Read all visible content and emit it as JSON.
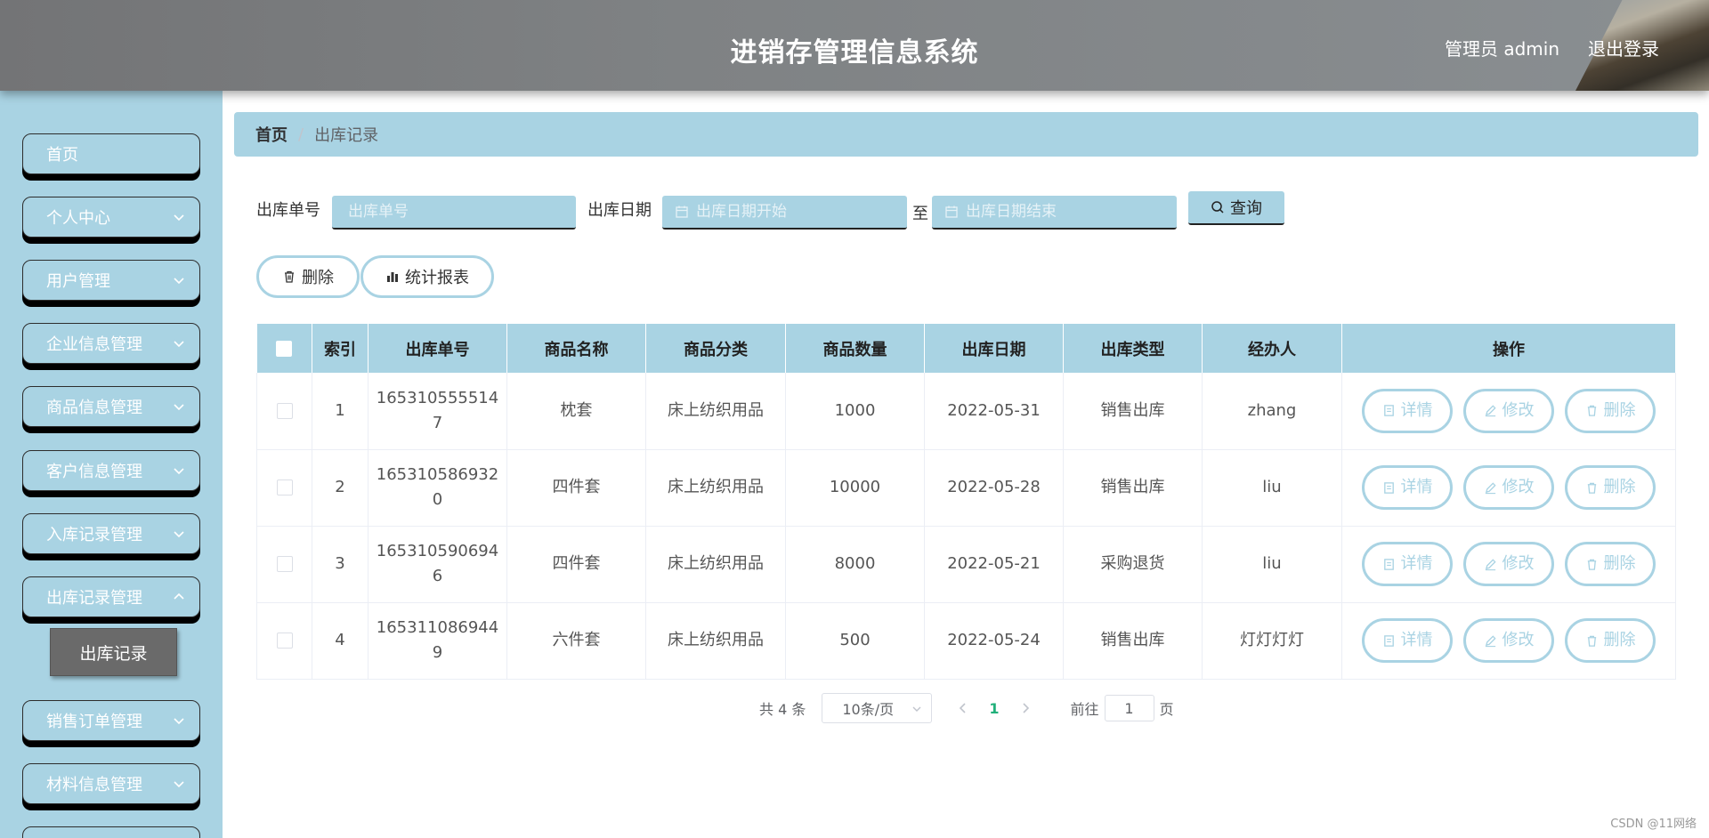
{
  "header": {
    "title": "进销存管理信息系统",
    "user": "管理员 admin",
    "logout": "退出登录"
  },
  "sidebar": {
    "items": [
      {
        "label": "首页",
        "expandable": false
      },
      {
        "label": "个人中心",
        "expandable": true
      },
      {
        "label": "用户管理",
        "expandable": true
      },
      {
        "label": "企业信息管理",
        "expandable": true
      },
      {
        "label": "商品信息管理",
        "expandable": true
      },
      {
        "label": "客户信息管理",
        "expandable": true
      },
      {
        "label": "入库记录管理",
        "expandable": true
      },
      {
        "label": "出库记录管理",
        "expandable": true
      },
      {
        "label": "销售订单管理",
        "expandable": true
      },
      {
        "label": "材料信息管理",
        "expandable": true
      }
    ],
    "active_sub": "出库记录"
  },
  "breadcrumb": {
    "home": "首页",
    "separator": "/",
    "current": "出库记录"
  },
  "search": {
    "order_label": "出库单号",
    "order_placeholder": "出库单号",
    "date_label": "出库日期",
    "date_start_placeholder": "出库日期开始",
    "date_to": "至",
    "date_end_placeholder": "出库日期结束",
    "query_button": "查询"
  },
  "actions": {
    "delete": "删除",
    "report": "统计报表"
  },
  "table": {
    "headers": [
      "索引",
      "出库单号",
      "商品名称",
      "商品分类",
      "商品数量",
      "出库日期",
      "出库类型",
      "经办人",
      "操作"
    ],
    "rows": [
      {
        "index": "1",
        "order_no": "1653105555147",
        "order_line1": "165310555514",
        "order_line2": "7",
        "product": "枕套",
        "category": "床上纺织用品",
        "qty": "1000",
        "date": "2022-05-31",
        "type": "销售出库",
        "handler": "zhang"
      },
      {
        "index": "2",
        "order_no": "1653105869320",
        "order_line1": "165310586932",
        "order_line2": "0",
        "product": "四件套",
        "category": "床上纺织用品",
        "qty": "10000",
        "date": "2022-05-28",
        "type": "销售出库",
        "handler": "liu"
      },
      {
        "index": "3",
        "order_no": "1653105906946",
        "order_line1": "165310590694",
        "order_line2": "6",
        "product": "四件套",
        "category": "床上纺织用品",
        "qty": "8000",
        "date": "2022-05-21",
        "type": "采购退货",
        "handler": "liu"
      },
      {
        "index": "4",
        "order_no": "1653110869449",
        "order_line1": "165311086944",
        "order_line2": "9",
        "product": "六件套",
        "category": "床上纺织用品",
        "qty": "500",
        "date": "2022-05-24",
        "type": "销售出库",
        "handler": "灯灯灯灯"
      }
    ],
    "row_actions": {
      "detail": "详情",
      "edit": "修改",
      "delete": "删除"
    }
  },
  "pagination": {
    "total": "共 4 条",
    "page_size": "10条/页",
    "current_page": "1",
    "goto_prefix": "前往",
    "goto_value": "1",
    "goto_suffix": "页"
  },
  "watermark": "CSDN @11网络",
  "colors": {
    "accent": "#a9d3e3",
    "header": "#7f8284",
    "submenu_active": "#6a6a6a",
    "page_active": "#21b07a"
  }
}
